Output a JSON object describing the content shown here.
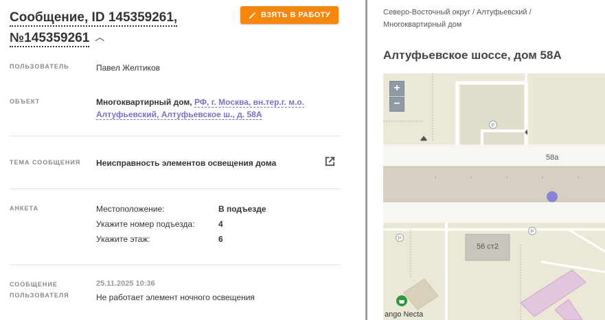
{
  "header": {
    "title": "Сообщение, ID 145359261, №145359261",
    "take_button": "ВЗЯТЬ В РАБОТУ"
  },
  "fields": {
    "user_label": "ПОЛЬЗОВАТЕЛЬ",
    "user_value": "Павел Желтиков",
    "object_label": "ОБЪЕКТ",
    "object_type": "Многоквартирный дом,",
    "object_address": "РФ, г. Москва, вн.тер.г. м.о. Алтуфьевский, Алтуфьевское ш., д. 58А",
    "topic_label": "ТЕМА СООБЩЕНИЯ",
    "topic_value": "Неисправность элементов освещения дома",
    "survey_label": "АНКЕТА",
    "survey": [
      {
        "key": "Местоположение:",
        "value": "В подъезде"
      },
      {
        "key": "Укажите номер подъезда:",
        "value": "4"
      },
      {
        "key": "Укажите этаж:",
        "value": "6"
      }
    ],
    "message_label_1": "СООБЩЕНИЕ",
    "message_label_2": "ПОЛЬЗОВАТЕЛЯ",
    "message_date": "25.11.2025 10:36",
    "message_text": "Не работает элемент ночного освещения"
  },
  "right": {
    "breadcrumb": "Северо-Восточный округ / Алтуфьевский / Многоквартирный дом",
    "place_title": "Алтуфьевское шоссе, дом 58А",
    "map": {
      "zoom_in": "+",
      "zoom_out": "−",
      "label_58a": "58а",
      "label_56": "56 ст2",
      "label_poi": "ango Necta",
      "parking": "P",
      "marker_color": "#8b82d6"
    }
  },
  "colors": {
    "accent": "#f5870f",
    "link": "#7b6fc9"
  }
}
